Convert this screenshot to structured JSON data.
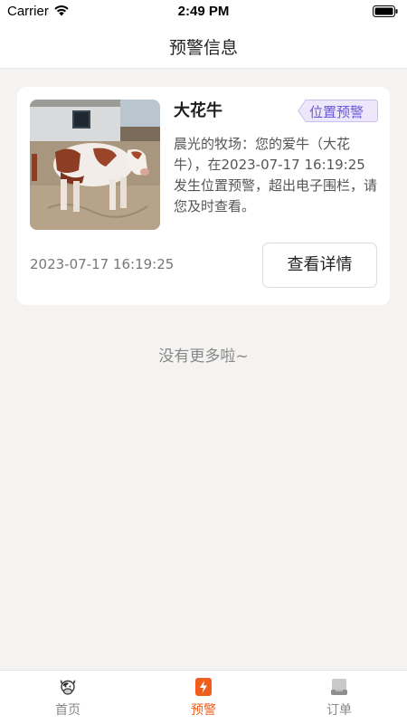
{
  "status_bar": {
    "carrier": "Carrier",
    "time": "2:49 PM"
  },
  "nav": {
    "title": "预警信息"
  },
  "alerts": [
    {
      "name": "大花牛",
      "tag": "位置预警",
      "message": "晨光的牧场：您的爱牛（大花牛），在2023-07-17 16:19:25发生位置预警，超出电子围栏，请您及时查看。",
      "time": "2023-07-17 16:19:25",
      "button_label": "查看详情"
    }
  ],
  "list_footer": "没有更多啦~",
  "tab_bar": {
    "active": "预警",
    "items": [
      {
        "label": "首页",
        "icon": "cow-icon"
      },
      {
        "label": "预警",
        "icon": "alert-icon"
      },
      {
        "label": "订单",
        "icon": "order-icon"
      }
    ]
  },
  "colors": {
    "accent": "#ef5e1c",
    "tag_purple": "#6b57d6",
    "background": "#f4f3f1"
  }
}
